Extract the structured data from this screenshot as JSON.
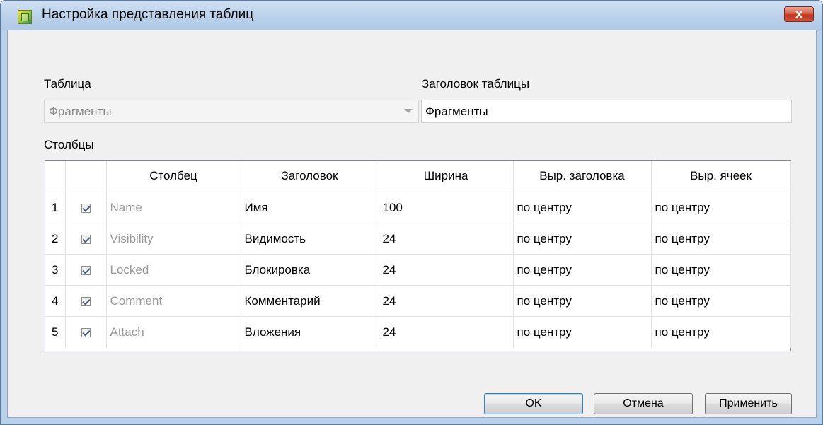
{
  "window": {
    "title": "Настройка представления таблиц",
    "close_label": "x"
  },
  "form": {
    "table_label": "Таблица",
    "table_value": "Фрагменты",
    "header_label": "Заголовок таблицы",
    "header_value": "Фрагменты",
    "columns_label": "Столбцы"
  },
  "grid": {
    "headers": [
      "Столбец",
      "Заголовок",
      "Ширина",
      "Выр. заголовка",
      "Выр. ячеек"
    ],
    "rows": [
      {
        "num": "1",
        "checked": true,
        "column": "Name",
        "caption": "Имя",
        "width": "100",
        "header_align": "по центру",
        "cell_align": "по центру"
      },
      {
        "num": "2",
        "checked": true,
        "column": "Visibility",
        "caption": "Видимость",
        "width": "24",
        "header_align": "по центру",
        "cell_align": "по центру"
      },
      {
        "num": "3",
        "checked": true,
        "column": "Locked",
        "caption": "Блокировка",
        "width": "24",
        "header_align": "по центру",
        "cell_align": "по центру"
      },
      {
        "num": "4",
        "checked": true,
        "column": "Comment",
        "caption": "Комментарий",
        "width": "24",
        "header_align": "по центру",
        "cell_align": "по центру"
      },
      {
        "num": "5",
        "checked": true,
        "column": "Attach",
        "caption": "Вложения",
        "width": "24",
        "header_align": "по центру",
        "cell_align": "по центру"
      }
    ]
  },
  "buttons": {
    "ok": "OK",
    "cancel": "Отмена",
    "apply": "Применить"
  },
  "colors": {
    "titlebar": "#bcd2eb",
    "close": "#c0381f",
    "client_bg": "#f0f0f0",
    "default_button_border": "#3c7fb1"
  },
  "icons": {
    "app": "table-settings-app-icon",
    "close": "close-icon",
    "dropdown": "chevron-down-icon",
    "check": "checkmark-icon"
  }
}
